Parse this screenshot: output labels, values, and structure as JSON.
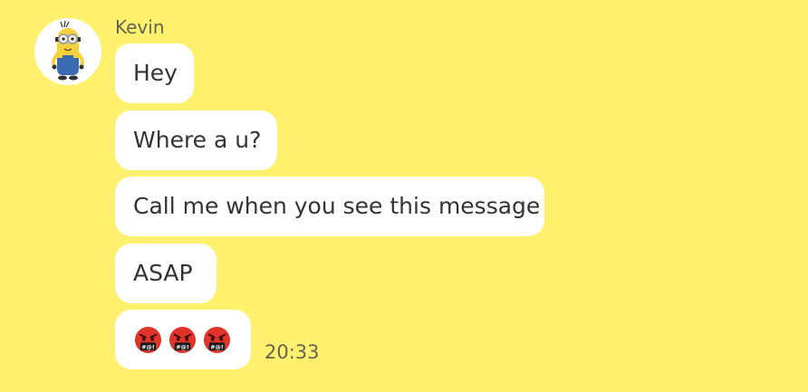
{
  "chat": {
    "sender_name": "Kevin",
    "avatar_icon": "minion-avatar-icon",
    "messages": [
      {
        "text": "Hey"
      },
      {
        "text": "Where a u?"
      },
      {
        "text": "Call me when you see this message"
      },
      {
        "text": "ASAP"
      },
      {
        "emojis": [
          "cursing-face-emoji",
          "cursing-face-emoji",
          "cursing-face-emoji"
        ]
      }
    ],
    "timestamp": "20:33"
  },
  "colors": {
    "background": "#FFF06E",
    "bubble": "#FFFFFF",
    "text": "#333333",
    "meta_text": "#666451"
  }
}
